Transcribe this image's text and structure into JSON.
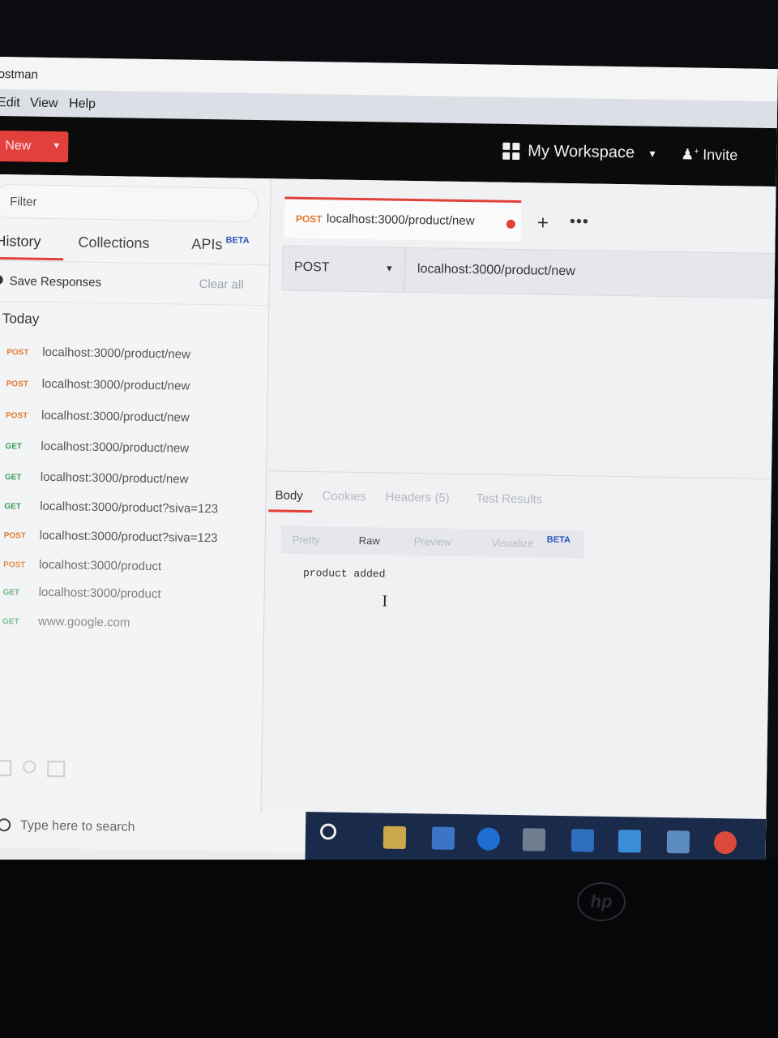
{
  "window": {
    "title": "ostman"
  },
  "menu": [
    "Edit",
    "View",
    "Help"
  ],
  "header": {
    "new_label": "New",
    "workspace_label": "My Workspace",
    "invite_label": "Invite"
  },
  "sidebar": {
    "filter_placeholder": "Filter",
    "tabs": [
      {
        "label": "History"
      },
      {
        "label": "Collections"
      },
      {
        "label": "APIs",
        "badge": "BETA"
      }
    ],
    "save_responses_label": "Save Responses",
    "clear_all_label": "Clear all",
    "section_label": "Today",
    "history": [
      {
        "method": "POST",
        "url": "localhost:3000/product/new"
      },
      {
        "method": "POST",
        "url": "localhost:3000/product/new"
      },
      {
        "method": "POST",
        "url": "localhost:3000/product/new"
      },
      {
        "method": "GET",
        "url": "localhost:3000/product/new"
      },
      {
        "method": "GET",
        "url": "localhost:3000/product/new"
      },
      {
        "method": "GET",
        "url": "localhost:3000/product?siva=123"
      },
      {
        "method": "POST",
        "url": "localhost:3000/product?siva=123"
      },
      {
        "method": "POST",
        "url": "localhost:3000/product"
      },
      {
        "method": "GET",
        "url": "localhost:3000/product"
      },
      {
        "method": "GET",
        "url": "www.google.com"
      }
    ]
  },
  "request": {
    "tab_method": "POST",
    "tab_url": "localhost:3000/product/new",
    "method": "POST",
    "url": "localhost:3000/product/new"
  },
  "response": {
    "tabs": [
      "Body",
      "Cookies",
      "Headers (5)",
      "Test Results"
    ],
    "formats": [
      "Pretty",
      "Raw",
      "Preview",
      "Visualize"
    ],
    "visualize_badge": "BETA",
    "body": "product added"
  },
  "taskbar": {
    "search_placeholder": "Type here to search"
  },
  "colors": {
    "accent": "#e2403a",
    "post": "#e07a2e",
    "get": "#3b9e5b",
    "beta": "#2f55b8"
  }
}
